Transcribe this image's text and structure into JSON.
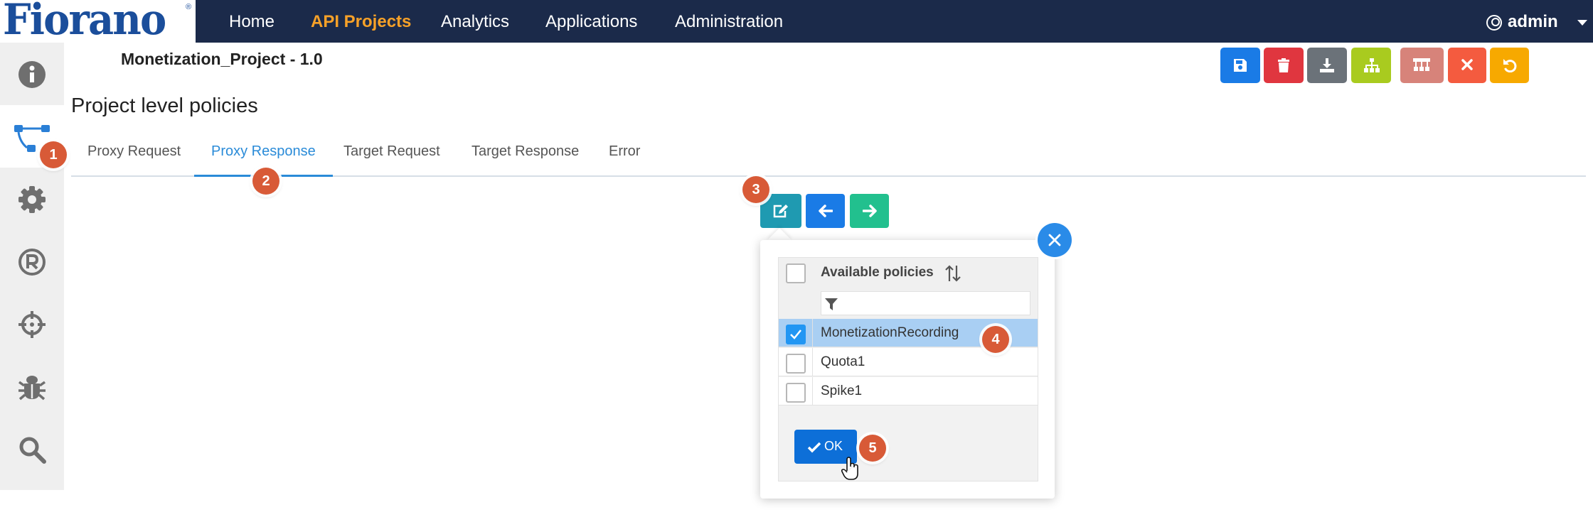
{
  "brand": {
    "logo_text": "Fiorano",
    "reg_mark": "®"
  },
  "navbar": {
    "items": [
      {
        "label": "Home",
        "active": false
      },
      {
        "label": "API Projects",
        "active": true
      },
      {
        "label": "Analytics",
        "active": false
      },
      {
        "label": "Applications",
        "active": false
      },
      {
        "label": "Administration",
        "active": false
      }
    ],
    "user_label": "admin"
  },
  "sidebar": {
    "items": [
      {
        "icon": "info-icon",
        "active": false
      },
      {
        "icon": "flow-icon",
        "active": true
      },
      {
        "icon": "gear-icon",
        "active": false
      },
      {
        "icon": "registered-icon",
        "active": false
      },
      {
        "icon": "crosshair-icon",
        "active": false
      },
      {
        "icon": "bug-icon",
        "active": false
      },
      {
        "icon": "search-icon",
        "active": false
      }
    ]
  },
  "project": {
    "title": "Monetization_Project - 1.0"
  },
  "toolbar": {
    "buttons": [
      {
        "icon": "save-icon",
        "color": "#1a7be6"
      },
      {
        "icon": "trash-icon",
        "color": "#e0363f"
      },
      {
        "icon": "download-icon",
        "color": "#6b7279"
      },
      {
        "icon": "sitemap-icon",
        "color": "#a9cb1f"
      },
      {
        "icon": "network-icon",
        "color": "#d7837a"
      },
      {
        "icon": "close-icon",
        "color": "#f45b3f"
      },
      {
        "icon": "undo-icon",
        "color": "#f7a900"
      }
    ]
  },
  "section": {
    "title": "Project level policies"
  },
  "tabs": [
    {
      "label": "Proxy Request",
      "active": false
    },
    {
      "label": "Proxy Response",
      "active": true
    },
    {
      "label": "Target Request",
      "active": false
    },
    {
      "label": "Target Response",
      "active": false
    },
    {
      "label": "Error",
      "active": false
    }
  ],
  "action_buttons": [
    {
      "icon": "edit-icon",
      "color": "#1f9ab1"
    },
    {
      "icon": "arrow-left-icon",
      "color": "#1a7be6"
    },
    {
      "icon": "arrow-right-icon",
      "color": "#22c08e"
    }
  ],
  "policies_popup": {
    "header": "Available policies",
    "filter_value": "",
    "items": [
      {
        "label": "MonetizationRecording",
        "checked": true
      },
      {
        "label": "Quota1",
        "checked": false
      },
      {
        "label": "Spike1",
        "checked": false
      }
    ],
    "ok_label": "OK"
  },
  "step_badges": [
    "1",
    "2",
    "3",
    "4",
    "5"
  ],
  "colors": {
    "navbar_bg": "#1b2a4a",
    "nav_active": "#f7a128",
    "tab_active": "#2a8bd8",
    "badge": "#d85a37",
    "selected_row": "#a9cff3"
  }
}
